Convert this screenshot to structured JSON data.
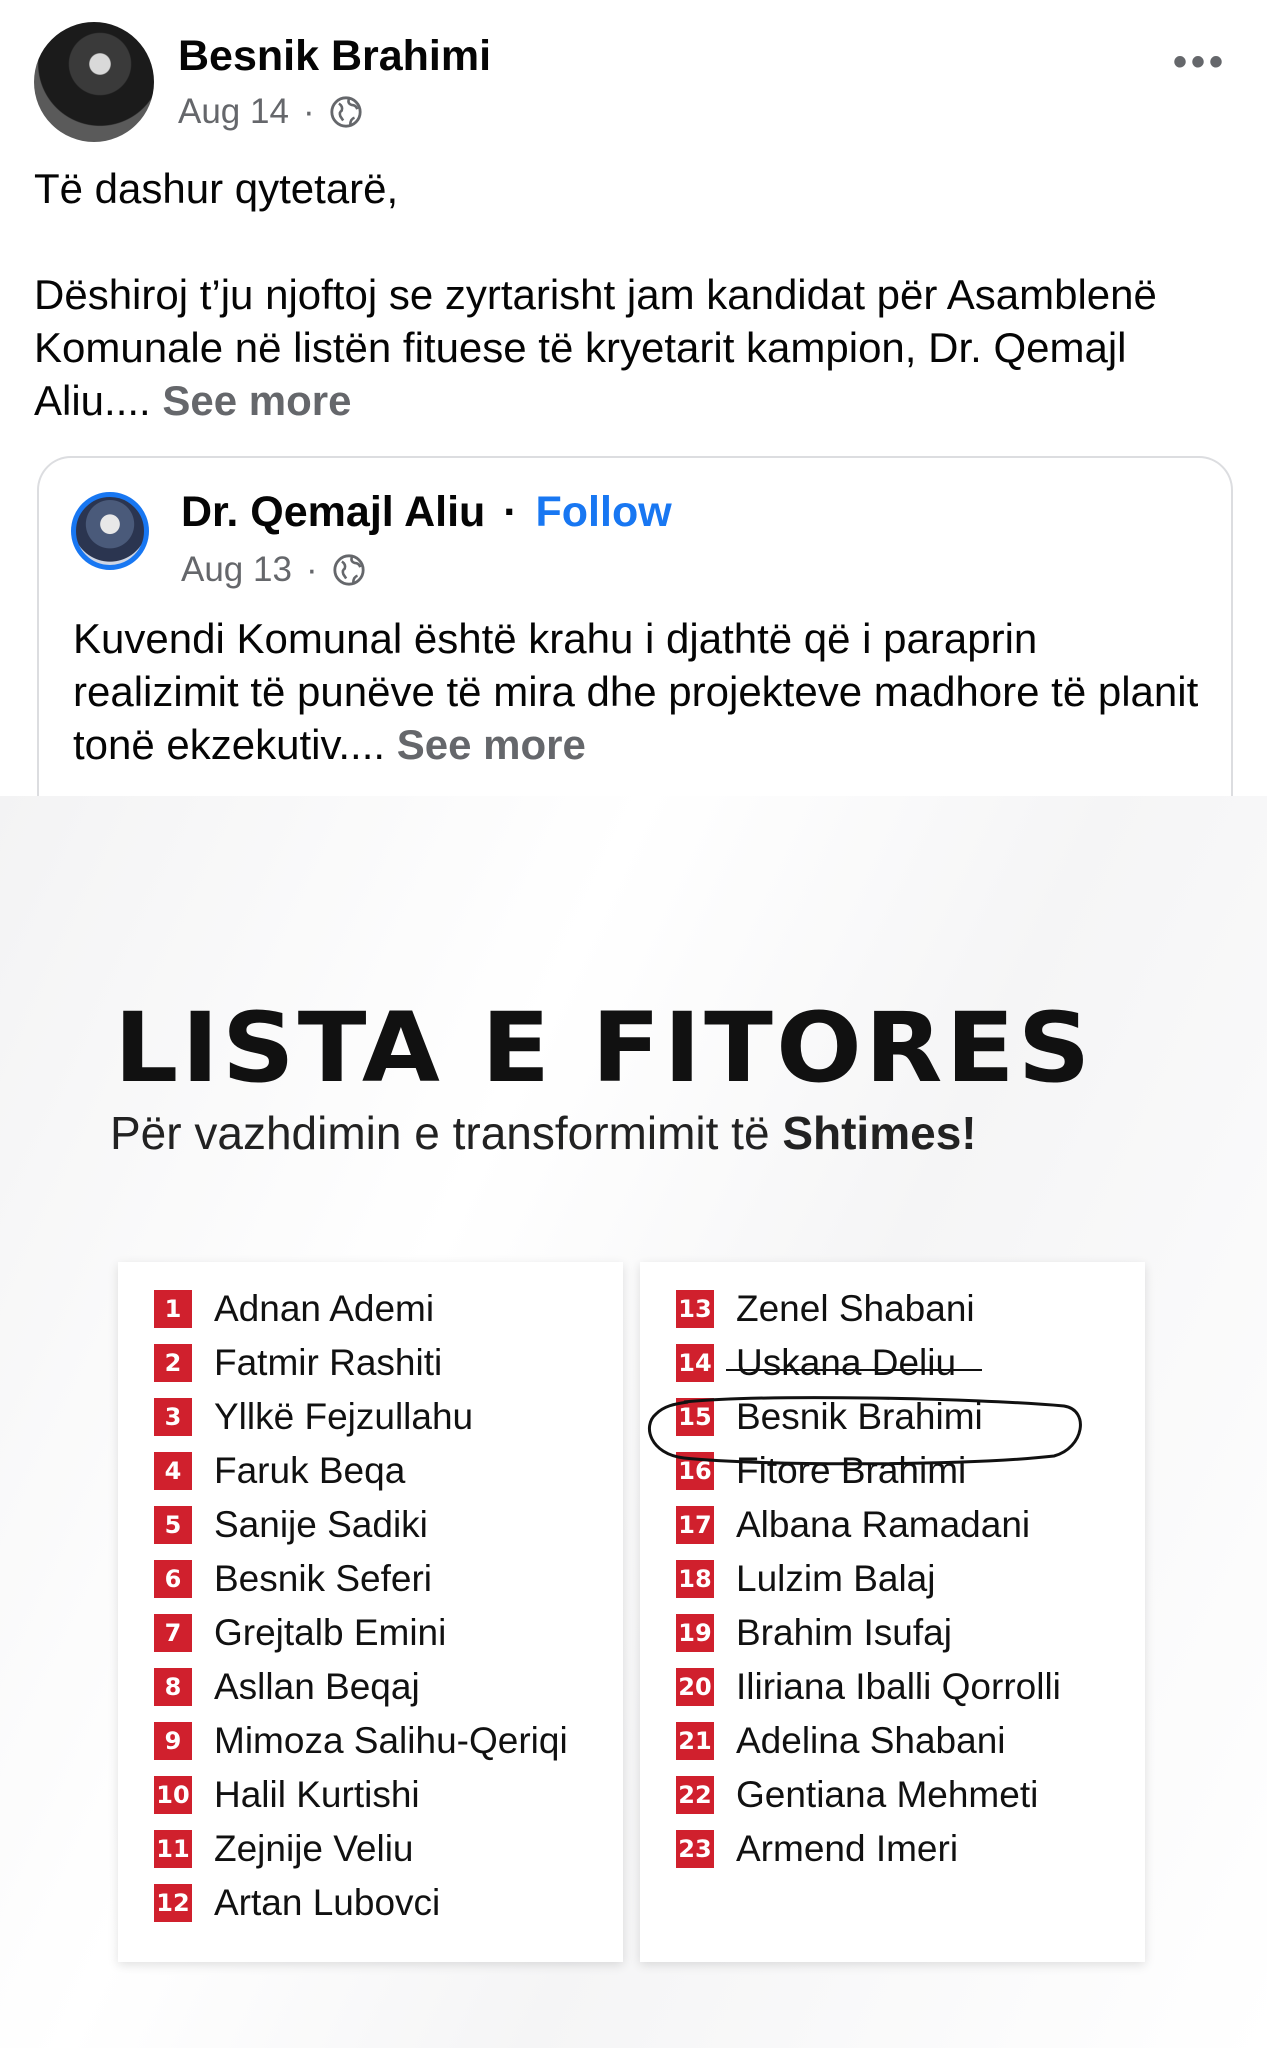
{
  "post": {
    "author": "Besnik Brahimi",
    "date": "Aug 14",
    "separator": "·",
    "more_icon": "more-horizontal-icon",
    "text_line1": "Të dashur qytetarë,",
    "text_body": "Dëshiroj t’ju njoftoj se zyrtarisht jam kandidat për Asamblenë Komunale në listën fituese të kryetarit kampion, Dr. Qemajl Aliu....",
    "see_more": "See more"
  },
  "shared_post": {
    "author": "Dr. Qemajl Aliu",
    "dot": "·",
    "follow": "Follow",
    "date": "Aug 13",
    "separator": "·",
    "text": "Kuvendi Komunal është krahu i djathtë që i paraprin realizimit të punëve të mira dhe projekteve madhore të planit tonë ekzekutiv....",
    "see_more": "See more"
  },
  "graphic": {
    "title": "LISTA E FITORES",
    "subtitle_plain": "Për vazhdimin e transformimit të ",
    "subtitle_bold": "Shtimes!",
    "accent_color": "#d0202d",
    "left_list": [
      {
        "num": "1",
        "name": "Adnan Ademi"
      },
      {
        "num": "2",
        "name": "Fatmir Rashiti"
      },
      {
        "num": "3",
        "name": "Yllkë Fejzullahu"
      },
      {
        "num": "4",
        "name": "Faruk Beqa"
      },
      {
        "num": "5",
        "name": "Sanije Sadiki"
      },
      {
        "num": "6",
        "name": "Besnik Seferi"
      },
      {
        "num": "7",
        "name": "Grejtalb Emini"
      },
      {
        "num": "8",
        "name": "Asllan Beqaj"
      },
      {
        "num": "9",
        "name": "Mimoza Salihu-Qeriqi"
      },
      {
        "num": "10",
        "name": "Halil Kurtishi"
      },
      {
        "num": "11",
        "name": "Zejnije Veliu"
      },
      {
        "num": "12",
        "name": "Artan Lubovci"
      }
    ],
    "right_list": [
      {
        "num": "13",
        "name": "Zenel Shabani"
      },
      {
        "num": "14",
        "name": "Uskana Deliu"
      },
      {
        "num": "15",
        "name": "Besnik Brahimi"
      },
      {
        "num": "16",
        "name": "Fitore Brahimi"
      },
      {
        "num": "17",
        "name": "Albana Ramadani"
      },
      {
        "num": "18",
        "name": "Lulzim Balaj"
      },
      {
        "num": "19",
        "name": "Brahim Isufaj"
      },
      {
        "num": "20",
        "name": "Iliriana Iballi Qorrolli"
      },
      {
        "num": "21",
        "name": "Adelina Shabani"
      },
      {
        "num": "22",
        "name": "Gentiana Mehmeti"
      },
      {
        "num": "23",
        "name": "Armend Imeri"
      }
    ]
  }
}
